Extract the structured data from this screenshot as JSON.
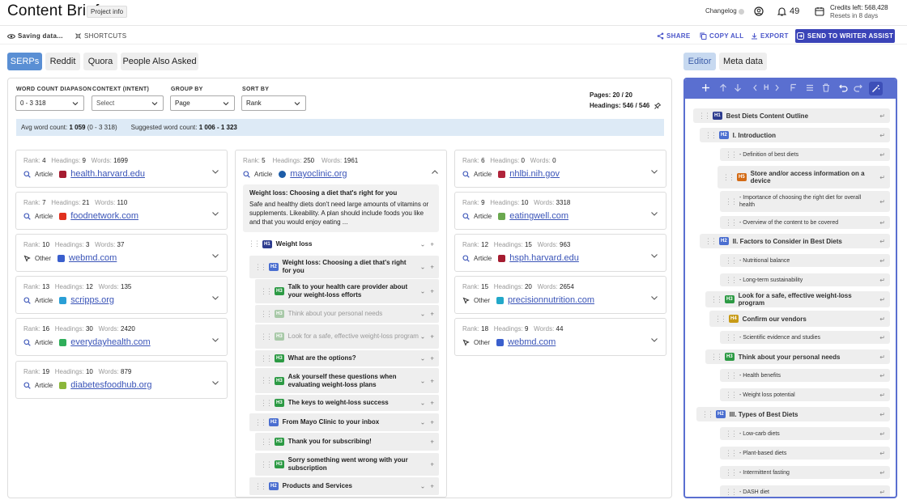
{
  "header": {
    "title": "Content Brief",
    "project_info": "Project info",
    "changelog": "Changelog",
    "notifications": "49",
    "credits_left": "Credits left: 568,428",
    "credits_reset": "Resets in 8 days"
  },
  "toolbar": {
    "saving": "Saving data...",
    "shortcuts": "SHORTCUTS",
    "share": "SHARE",
    "copy_all": "COPY ALL",
    "export": "EXPORT",
    "send": "SEND TO WRITER ASSIST"
  },
  "tabs": [
    "SERPs",
    "Reddit",
    "Quora",
    "People Also Asked"
  ],
  "editor_tabs": [
    "Editor",
    "Meta data"
  ],
  "filters": {
    "word_count_label": "WORD COUNT DIAPASON",
    "word_count_value": "0 - 3 318",
    "context_label": "CONTEXT (INTENT)",
    "context_value": "Select",
    "group_label": "GROUP BY",
    "group_value": "Page",
    "sort_label": "SORT BY",
    "sort_value": "Rank",
    "pages": "Pages: 20 / 20",
    "headings": "Headings: 546 / 546"
  },
  "summary": {
    "avg_label": "Avg word count:",
    "avg_value": "1 059",
    "avg_range": "(0 - 3 318)",
    "suggested_label": "Suggested word count:",
    "suggested_value": "1 006 - 1 323"
  },
  "card_labels": {
    "rank": "Rank:",
    "headings": "Headings:",
    "words": "Words:"
  },
  "cards": [
    {
      "rank": "4",
      "headings": "9",
      "words": "1699",
      "type": "Article",
      "domain": "health.harvard.edu",
      "color": "#a51c30"
    },
    {
      "rank": "7",
      "headings": "21",
      "words": "110",
      "type": "Article",
      "domain": "foodnetwork.com",
      "color": "#e0301e"
    },
    {
      "rank": "10",
      "headings": "3",
      "words": "37",
      "type": "Other",
      "domain": "webmd.com",
      "color": "#3a5fcd"
    },
    {
      "rank": "13",
      "headings": "12",
      "words": "135",
      "type": "Article",
      "domain": "scripps.org",
      "color": "#2a9fd6"
    },
    {
      "rank": "16",
      "headings": "30",
      "words": "2420",
      "type": "Article",
      "domain": "everydayhealth.com",
      "color": "#2fae5a"
    },
    {
      "rank": "19",
      "headings": "10",
      "words": "879",
      "type": "Article",
      "domain": "diabetesfoodhub.org",
      "color": "#8bb63a"
    },
    {
      "rank": "6",
      "headings": "0",
      "words": "0",
      "type": "Article",
      "domain": "nhlbi.nih.gov",
      "color": "#b0243a"
    },
    {
      "rank": "9",
      "headings": "10",
      "words": "3318",
      "type": "Article",
      "domain": "eatingwell.com",
      "color": "#6aa84f"
    },
    {
      "rank": "12",
      "headings": "15",
      "words": "963",
      "type": "Article",
      "domain": "hsph.harvard.edu",
      "color": "#a51c30"
    },
    {
      "rank": "15",
      "headings": "20",
      "words": "2654",
      "type": "Other",
      "domain": "precisionnutrition.com",
      "color": "#22a8c9"
    },
    {
      "rank": "18",
      "headings": "9",
      "words": "44",
      "type": "Other",
      "domain": "webmd.com",
      "color": "#3a5fcd"
    }
  ],
  "expanded": {
    "rank": "5",
    "headings": "250",
    "words": "1961",
    "type": "Article",
    "domain": "mayoclinic.org",
    "color": "#1d5da8",
    "snippet_title": "Weight loss: Choosing a diet that's right for you",
    "snippet_text": "Safe and healthy diets don't need large amounts of vitamins or supplements. Likeability. A plan should include foods you like and that you would enjoy eating ...",
    "outline": [
      {
        "level": "H1",
        "text": "Weight loss"
      },
      {
        "level": "H2",
        "text": "Weight loss: Choosing a diet that's right for you"
      },
      {
        "level": "H3",
        "text": "Talk to your health care provider about your weight-loss efforts"
      },
      {
        "level": "H3",
        "text": "Think about your personal needs"
      },
      {
        "level": "H3",
        "text": "Look for a safe, effective weight-loss program"
      },
      {
        "level": "H3",
        "text": "What are the options?"
      },
      {
        "level": "H3",
        "text": "Ask yourself these questions when evaluating weight-loss plans"
      },
      {
        "level": "H3",
        "text": "The keys to weight-loss success"
      },
      {
        "level": "H2",
        "text": "From Mayo Clinic to your inbox"
      },
      {
        "level": "H3",
        "text": "Thank you for subscribing!"
      },
      {
        "level": "H3",
        "text": "Sorry something went wrong with your subscription"
      },
      {
        "level": "H2",
        "text": "Products and Services"
      }
    ]
  },
  "editor": {
    "toolbar_icons": [
      "plus-icon",
      "arrow-up-icon",
      "arrow-down-icon",
      "chevron-left-icon",
      "heading-icon",
      "chevron-right-icon",
      "paragraph-icon",
      "list-icon",
      "trash-icon",
      "undo-icon",
      "redo-icon",
      "magic-wand-icon"
    ],
    "heading_glyph": "H",
    "return_glyph": "↵",
    "items": [
      {
        "level": "H1",
        "text": "Best Diets Content Outline"
      },
      {
        "level": "H2",
        "text": "I. Introduction"
      },
      {
        "level": "",
        "text": "- Definition of best diets"
      },
      {
        "level": "H5",
        "text": "Store and/or access information on a device"
      },
      {
        "level": "",
        "text": "- Importance of choosing the right diet for overall health"
      },
      {
        "level": "",
        "text": "- Overview of the content to be covered"
      },
      {
        "level": "H2",
        "text": "II. Factors to Consider in Best Diets"
      },
      {
        "level": "",
        "text": "- Nutritional balance"
      },
      {
        "level": "",
        "text": "- Long-term sustainability"
      },
      {
        "level": "H3",
        "text": "Look for a safe, effective weight-loss program"
      },
      {
        "level": "H4",
        "text": "Confirm our vendors"
      },
      {
        "level": "",
        "text": "- Scientific evidence and studies"
      },
      {
        "level": "H3",
        "text": "Think about your personal needs"
      },
      {
        "level": "",
        "text": "- Health benefits"
      },
      {
        "level": "",
        "text": "- Weight loss potential"
      },
      {
        "level": "H2",
        "text": "III. Types of Best Diets"
      },
      {
        "level": "",
        "text": "- Low-carb diets"
      },
      {
        "level": "",
        "text": "- Plant-based diets"
      },
      {
        "level": "",
        "text": "- Intermittent fasting"
      },
      {
        "level": "",
        "text": "- DASH diet"
      }
    ]
  },
  "colors": {
    "accent": "#3b44b8",
    "tab_active": "#5a8fd4",
    "editor_border": "#5a6fd0",
    "summary_bg": "#ddeaf6"
  }
}
